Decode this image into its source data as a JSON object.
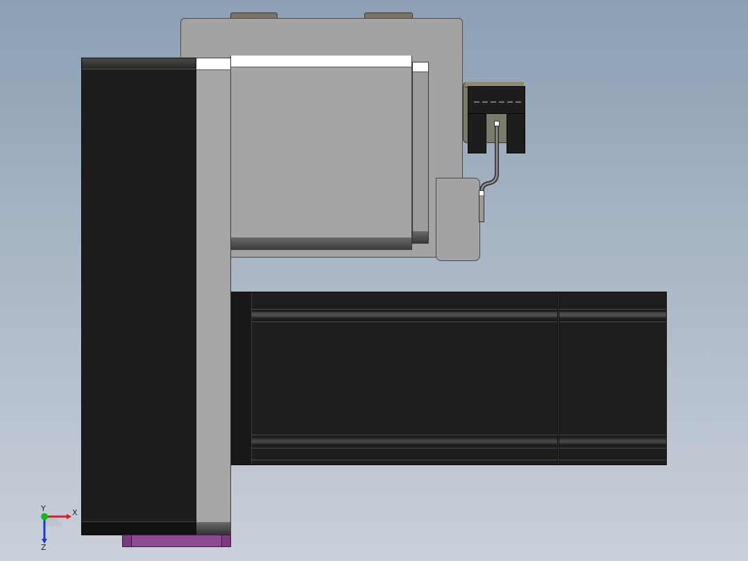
{
  "view": {
    "background_top": "#8c9fb4",
    "background_bottom": "#c9d0da"
  },
  "parts": {
    "motor_color": "#1d1d1d",
    "plate_color": "#a6a6a6",
    "base_color": "#7b3a7e",
    "sensor_bracket_color": "#7a7b68"
  },
  "triad": {
    "x_label": "X",
    "y_label": "Y",
    "z_label": "Z",
    "x_color": "#d42020",
    "y_color": "#16b916",
    "z_color": "#1c37d4"
  }
}
